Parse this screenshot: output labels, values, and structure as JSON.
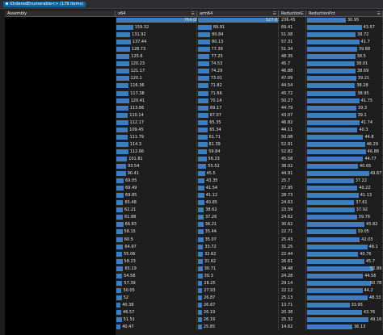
{
  "window": {
    "title": "IOrderedEnumerable<> (179 Items)"
  },
  "columns": [
    {
      "key": "assembly",
      "label": "Assembly"
    },
    {
      "key": "x64",
      "label": "x64"
    },
    {
      "key": "arm64",
      "label": "arm64"
    },
    {
      "key": "reduction",
      "label": "Reduction"
    },
    {
      "key": "reduction_pct",
      "label": "ReductionPct"
    }
  ],
  "rows": [
    {
      "x64": "764.08",
      "arm64": "527.63",
      "reduction": "236.45",
      "reduction_pct": "30.95"
    },
    {
      "x64": "159.32",
      "arm64": "89.91",
      "reduction": "69.41",
      "reduction_pct": "43.57"
    },
    {
      "x64": "131.92",
      "arm64": "80.84",
      "reduction": "51.08",
      "reduction_pct": "38.72"
    },
    {
      "x64": "137.44",
      "arm64": "80.13",
      "reduction": "57.31",
      "reduction_pct": "41.7"
    },
    {
      "x64": "128.73",
      "arm64": "77.39",
      "reduction": "51.34",
      "reduction_pct": "39.88"
    },
    {
      "x64": "125.6",
      "arm64": "77.25",
      "reduction": "48.35",
      "reduction_pct": "38.5"
    },
    {
      "x64": "120.23",
      "arm64": "74.53",
      "reduction": "45.7",
      "reduction_pct": "38.01"
    },
    {
      "x64": "121.17",
      "arm64": "74.29",
      "reduction": "46.88",
      "reduction_pct": "38.69"
    },
    {
      "x64": "120.1",
      "arm64": "73.01",
      "reduction": "47.09",
      "reduction_pct": "39.21"
    },
    {
      "x64": "116.36",
      "arm64": "71.82",
      "reduction": "44.54",
      "reduction_pct": "38.28"
    },
    {
      "x64": "117.38",
      "arm64": "71.66",
      "reduction": "45.72",
      "reduction_pct": "38.95"
    },
    {
      "x64": "120.41",
      "arm64": "70.14",
      "reduction": "50.27",
      "reduction_pct": "41.75"
    },
    {
      "x64": "113.86",
      "arm64": "69.17",
      "reduction": "44.79",
      "reduction_pct": "39.3"
    },
    {
      "x64": "110.14",
      "arm64": "67.07",
      "reduction": "43.07",
      "reduction_pct": "39.1"
    },
    {
      "x64": "112.17",
      "arm64": "65.35",
      "reduction": "46.82",
      "reduction_pct": "41.74"
    },
    {
      "x64": "109.45",
      "arm64": "65.34",
      "reduction": "44.11",
      "reduction_pct": "40.3"
    },
    {
      "x64": "111.79",
      "arm64": "61.71",
      "reduction": "50.08",
      "reduction_pct": "44.8"
    },
    {
      "x64": "114.3",
      "arm64": "61.39",
      "reduction": "52.91",
      "reduction_pct": "46.29"
    },
    {
      "x64": "112.66",
      "arm64": "59.84",
      "reduction": "52.82",
      "reduction_pct": "46.88"
    },
    {
      "x64": "101.81",
      "arm64": "56.23",
      "reduction": "45.58",
      "reduction_pct": "44.77"
    },
    {
      "x64": "93.54",
      "arm64": "55.52",
      "reduction": "38.02",
      "reduction_pct": "40.65"
    },
    {
      "x64": "90.41",
      "arm64": "45.5",
      "reduction": "44.91",
      "reduction_pct": "49.67"
    },
    {
      "x64": "69.05",
      "arm64": "43.35",
      "reduction": "25.7",
      "reduction_pct": "37.22"
    },
    {
      "x64": "69.49",
      "arm64": "41.54",
      "reduction": "27.95",
      "reduction_pct": "40.22"
    },
    {
      "x64": "69.85",
      "arm64": "41.12",
      "reduction": "28.73",
      "reduction_pct": "41.13"
    },
    {
      "x64": "65.48",
      "arm64": "40.85",
      "reduction": "24.63",
      "reduction_pct": "37.61"
    },
    {
      "x64": "62.21",
      "arm64": "38.62",
      "reduction": "23.59",
      "reduction_pct": "37.92"
    },
    {
      "x64": "61.88",
      "arm64": "37.26",
      "reduction": "24.62",
      "reduction_pct": "39.79"
    },
    {
      "x64": "66.83",
      "arm64": "36.21",
      "reduction": "30.62",
      "reduction_pct": "45.82"
    },
    {
      "x64": "58.15",
      "arm64": "35.44",
      "reduction": "22.71",
      "reduction_pct": "39.05"
    },
    {
      "x64": "60.5",
      "arm64": "35.07",
      "reduction": "25.43",
      "reduction_pct": "42.03"
    },
    {
      "x64": "64.97",
      "arm64": "33.72",
      "reduction": "31.25",
      "reduction_pct": "48.1"
    },
    {
      "x64": "55.06",
      "arm64": "32.62",
      "reduction": "22.44",
      "reduction_pct": "40.76"
    },
    {
      "x64": "58.23",
      "arm64": "31.62",
      "reduction": "26.61",
      "reduction_pct": "45.7"
    },
    {
      "x64": "65.19",
      "arm64": "30.71",
      "reduction": "34.48",
      "reduction_pct": "52.89"
    },
    {
      "x64": "54.58",
      "arm64": "30.3",
      "reduction": "24.28",
      "reduction_pct": "44.56"
    },
    {
      "x64": "57.39",
      "arm64": "28.25",
      "reduction": "29.14",
      "reduction_pct": "50.78"
    },
    {
      "x64": "50.05",
      "arm64": "27.93",
      "reduction": "22.12",
      "reduction_pct": "44.2"
    },
    {
      "x64": "52",
      "arm64": "26.87",
      "reduction": "25.13",
      "reduction_pct": "48.33"
    },
    {
      "x64": "40.38",
      "arm64": "26.67",
      "reduction": "13.71",
      "reduction_pct": "33.95"
    },
    {
      "x64": "46.57",
      "arm64": "26.19",
      "reduction": "20.38",
      "reduction_pct": "43.76"
    },
    {
      "x64": "51.51",
      "arm64": "26.19",
      "reduction": "25.32",
      "reduction_pct": "49.16"
    },
    {
      "x64": "40.47",
      "arm64": "25.85",
      "reduction": "14.62",
      "reduction_pct": "36.13"
    }
  ]
}
